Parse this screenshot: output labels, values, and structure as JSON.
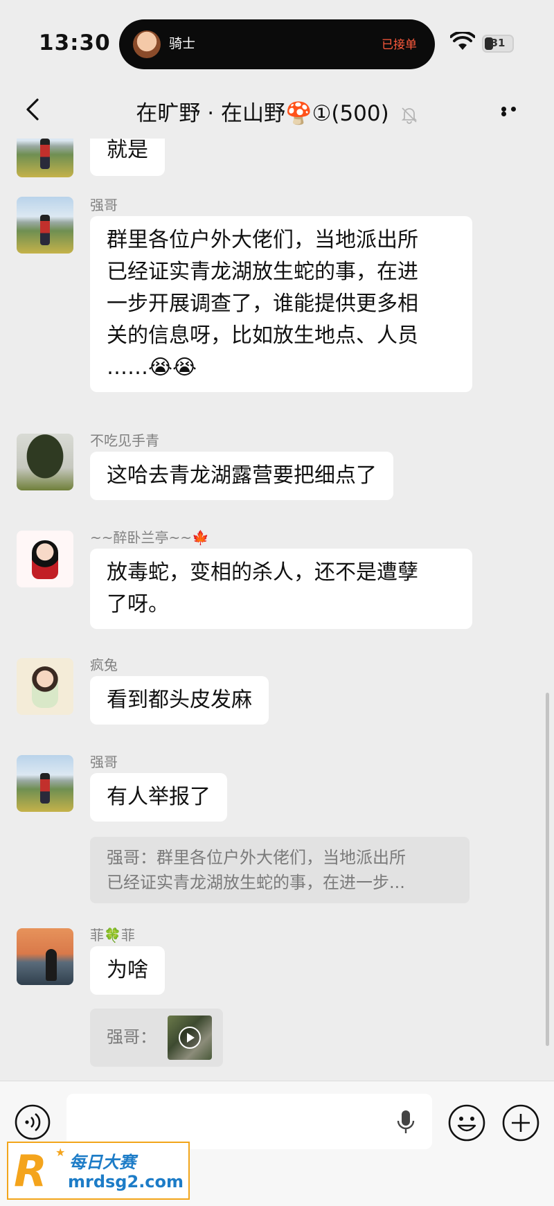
{
  "status_bar": {
    "time": "13:30",
    "island_label": "骑士",
    "island_status": "已接单",
    "battery": "31",
    "battery_level": 0.31
  },
  "header": {
    "title": "在旷野 · 在山野🍄①(500)",
    "icons": [
      "back-icon",
      "bell-muted-icon",
      "more-icon"
    ]
  },
  "messages": [
    {
      "sender": "",
      "avatar": "mountain-hiker",
      "lines": [
        "就是"
      ]
    },
    {
      "sender": "强哥",
      "avatar": "mountain-hiker",
      "lines": [
        "群里各位户外大佬们，当地派出所",
        "已经证实青龙湖放生蛇的事，在进",
        "一步开展调查了，谁能提供更多相",
        "关的信息呀，比如放生地点、人员",
        "……😭😭"
      ]
    },
    {
      "sender": "不吃见手青",
      "avatar": "tree",
      "lines": [
        "这哈去青龙湖露营要把细点了"
      ]
    },
    {
      "sender": "~~醉卧兰亭~~🍁",
      "avatar": "cartoon-girl",
      "lines": [
        "放毒蛇，变相的杀人，还不是遭孽",
        "了呀。"
      ]
    },
    {
      "sender": "疯兔",
      "avatar": "lotus-girl",
      "lines": [
        "看到都头皮发麻"
      ]
    },
    {
      "sender": "强哥",
      "avatar": "mountain-hiker",
      "lines": [
        "有人举报了"
      ],
      "quote": [
        "强哥：群里各位户外大佬们，当地派出所",
        "已经证实青龙湖放生蛇的事，在进一步..."
      ]
    },
    {
      "sender": "菲🍀菲",
      "avatar": "sunset",
      "lines": [
        "为啥"
      ],
      "quote": [
        "强哥："
      ],
      "quote_has_video": true
    }
  ],
  "input_bar": {
    "icons": [
      "voice-icon",
      "mic-icon",
      "emoji-icon",
      "plus-icon"
    ]
  },
  "watermark": {
    "logo": "R",
    "brand": "每日大赛",
    "url": "mrdsg2.com"
  },
  "colors": {
    "background": "#ededed",
    "bubble": "#ffffff",
    "quote_bg": "#e2e2e2",
    "accent_orange": "#ff5a3c",
    "watermark_orange": "#f4a41c",
    "watermark_blue": "#1d7cc7"
  }
}
